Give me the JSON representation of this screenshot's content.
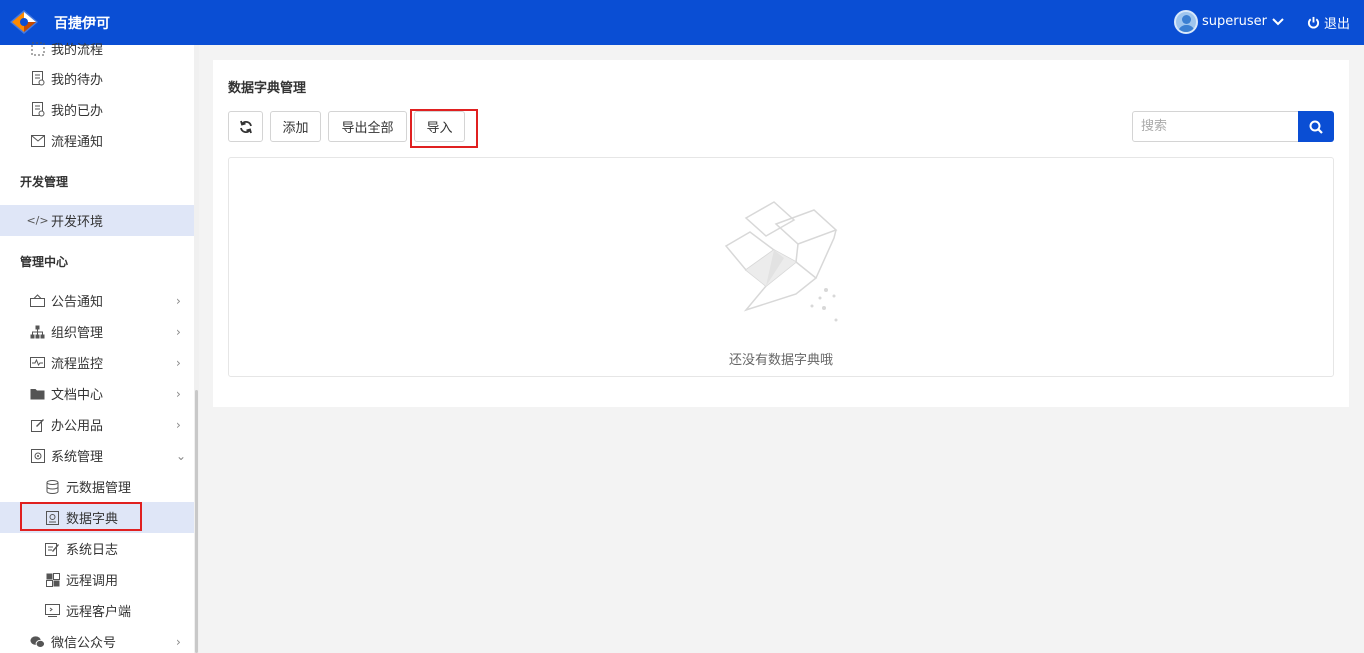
{
  "header": {
    "app_title": "百捷伊可",
    "username": "superuser",
    "logout_label": "退出",
    "brand_color": "#0a4ed4"
  },
  "sidebar": {
    "items_top": [
      {
        "label": "我的流程",
        "icon": "flow-icon"
      },
      {
        "label": "我的待办",
        "icon": "todo-doc-icon"
      },
      {
        "label": "我的已办",
        "icon": "done-doc-icon"
      },
      {
        "label": "流程通知",
        "icon": "mail-icon"
      }
    ],
    "section_dev": "开发管理",
    "dev_env": "开发环境",
    "section_admin": "管理中心",
    "admin_items": [
      {
        "label": "公告通知",
        "icon": "announcement-icon"
      },
      {
        "label": "组织管理",
        "icon": "org-tree-icon"
      },
      {
        "label": "流程监控",
        "icon": "monitor-icon"
      },
      {
        "label": "文档中心",
        "icon": "folder-icon"
      },
      {
        "label": "办公用品",
        "icon": "edit-icon"
      },
      {
        "label": "系统管理",
        "icon": "settings-icon"
      }
    ],
    "system_subitems": [
      {
        "label": "元数据管理",
        "icon": "database-icon"
      },
      {
        "label": "数据字典",
        "icon": "dictionary-icon"
      },
      {
        "label": "系统日志",
        "icon": "log-icon"
      },
      {
        "label": "远程调用",
        "icon": "remote-call-icon"
      },
      {
        "label": "远程客户端",
        "icon": "remote-client-icon"
      }
    ],
    "wechat": "微信公众号"
  },
  "main": {
    "title": "数据字典管理",
    "buttons": {
      "add": "添加",
      "export_all": "导出全部",
      "import": "导入"
    },
    "search_placeholder": "搜索",
    "empty_text": "还没有数据字典哦"
  }
}
